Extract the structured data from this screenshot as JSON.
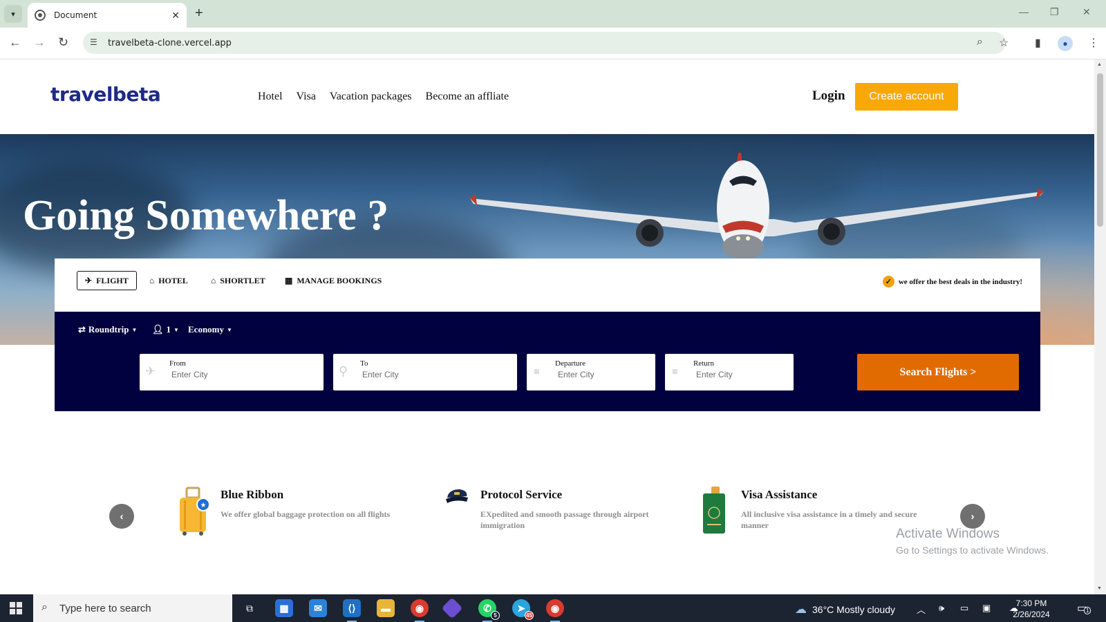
{
  "browser": {
    "tab_title": "Document",
    "url": "travelbeta-clone.vercel.app"
  },
  "site": {
    "logo": "travelbeta",
    "nav": [
      "Hotel",
      "Visa",
      "Vacation packages",
      "Become an affliate"
    ],
    "login": "Login",
    "create_account": "Create account"
  },
  "hero": {
    "title": "Going Somewhere ?"
  },
  "booking": {
    "tabs": [
      "FLIGHT",
      "HOTEL",
      "SHORTLET",
      "MANAGE BOOKINGS"
    ],
    "active_tab": "FLIGHT",
    "deal_text": "we offer the best deals in the industry!",
    "options": {
      "trip": "Roundtrip",
      "passengers": "1",
      "cabin": "Economy"
    },
    "fields": {
      "from_label": "From",
      "from_placeholder": "Enter City",
      "to_label": "To",
      "to_placeholder": "Enter City",
      "departure_label": "Departure",
      "departure_placeholder": "Enter City",
      "return_label": "Return",
      "return_placeholder": "Enter City"
    },
    "search_button": "Search Flights >"
  },
  "features": [
    {
      "title": "Blue Ribbon",
      "text": "We offer global baggage protection on all flights",
      "icon": "luggage-icon"
    },
    {
      "title": "Protocol Service",
      "text": "EXpedited and smooth passage through airport immigration",
      "icon": "pilot-cap-icon"
    },
    {
      "title": "Visa Assistance",
      "text": "All inclusive visa assistance in a timely and secure manner",
      "icon": "passport-icon"
    }
  ],
  "watermark": {
    "line1": "Activate Windows",
    "line2": "Go to Settings to activate Windows."
  },
  "taskbar": {
    "search_placeholder": "Type here to search",
    "weather": "36°C  Mostly cloudy",
    "time": "7:30 PM",
    "date": "2/26/2024",
    "whatsapp_badge": "5",
    "telegram_badge": "45",
    "notifications_badge": "1"
  },
  "colors": {
    "accent_orange": "#f8a907",
    "search_orange": "#e26b00",
    "panel_navy": "#02013f",
    "logo_blue": "#1e2a88"
  }
}
